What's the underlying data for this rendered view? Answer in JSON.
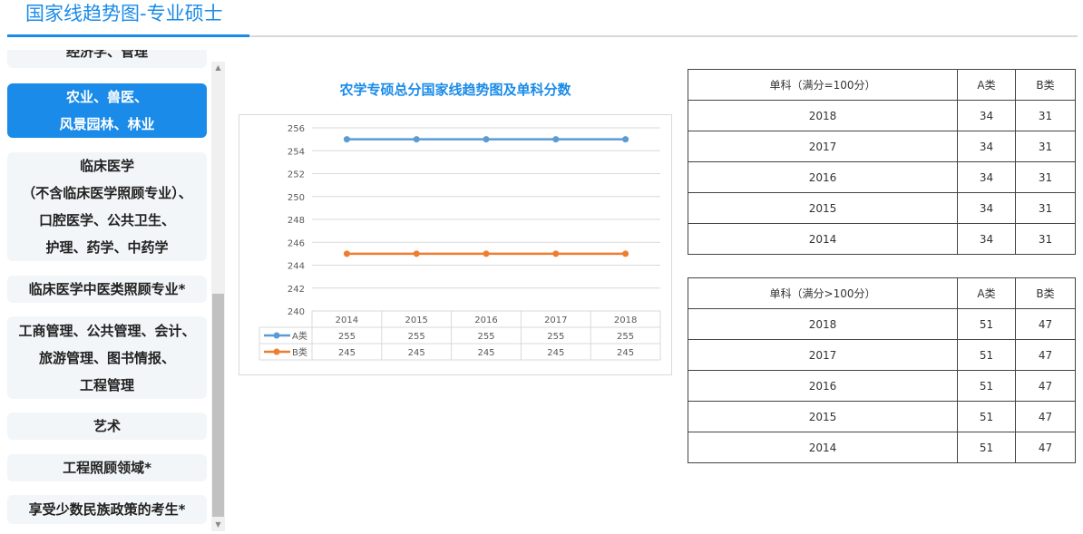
{
  "header": {
    "title": "国家线趋势图-专业硕士"
  },
  "sidebar": {
    "items": [
      {
        "label": "经济学、管理"
      },
      {
        "label": "农业、兽医、\n风景园林、林业",
        "active": true
      },
      {
        "label": "临床医学\n（不含临床医学照顾专业）、\n口腔医学、公共卫生、\n护理、药学、中药学"
      },
      {
        "label": "临床医学中医类照顾专业*"
      },
      {
        "label": "工商管理、公共管理、会计、\n旅游管理、图书情报、\n工程管理"
      },
      {
        "label": "艺术"
      },
      {
        "label": "工程照顾领域*"
      },
      {
        "label": "享受少数民族政策的考生*"
      }
    ],
    "scroll_up_icon": "▲",
    "scroll_down_icon": "▼"
  },
  "chart_title": "农学专硕总分国家线趋势图及单科分数",
  "chart_data": {
    "type": "line",
    "categories": [
      "2014",
      "2015",
      "2016",
      "2017",
      "2018"
    ],
    "series": [
      {
        "name": "A类",
        "values": [
          255,
          255,
          255,
          255,
          255
        ],
        "color": "#5b9bd5"
      },
      {
        "name": "B类",
        "values": [
          245,
          245,
          245,
          245,
          245
        ],
        "color": "#ed7d31"
      }
    ],
    "ylim": [
      240,
      256
    ],
    "yticks": [
      240,
      242,
      244,
      246,
      248,
      250,
      252,
      254,
      256
    ],
    "grid": true,
    "legend": "data-table"
  },
  "tables": [
    {
      "header": [
        "单科（满分=100分）",
        "A类",
        "B类"
      ],
      "rows": [
        [
          "2018",
          "34",
          "31"
        ],
        [
          "2017",
          "34",
          "31"
        ],
        [
          "2016",
          "34",
          "31"
        ],
        [
          "2015",
          "34",
          "31"
        ],
        [
          "2014",
          "34",
          "31"
        ]
      ]
    },
    {
      "header": [
        "单科（满分>100分）",
        "A类",
        "B类"
      ],
      "rows": [
        [
          "2018",
          "51",
          "47"
        ],
        [
          "2017",
          "51",
          "47"
        ],
        [
          "2016",
          "51",
          "47"
        ],
        [
          "2015",
          "51",
          "47"
        ],
        [
          "2014",
          "51",
          "47"
        ]
      ]
    }
  ]
}
